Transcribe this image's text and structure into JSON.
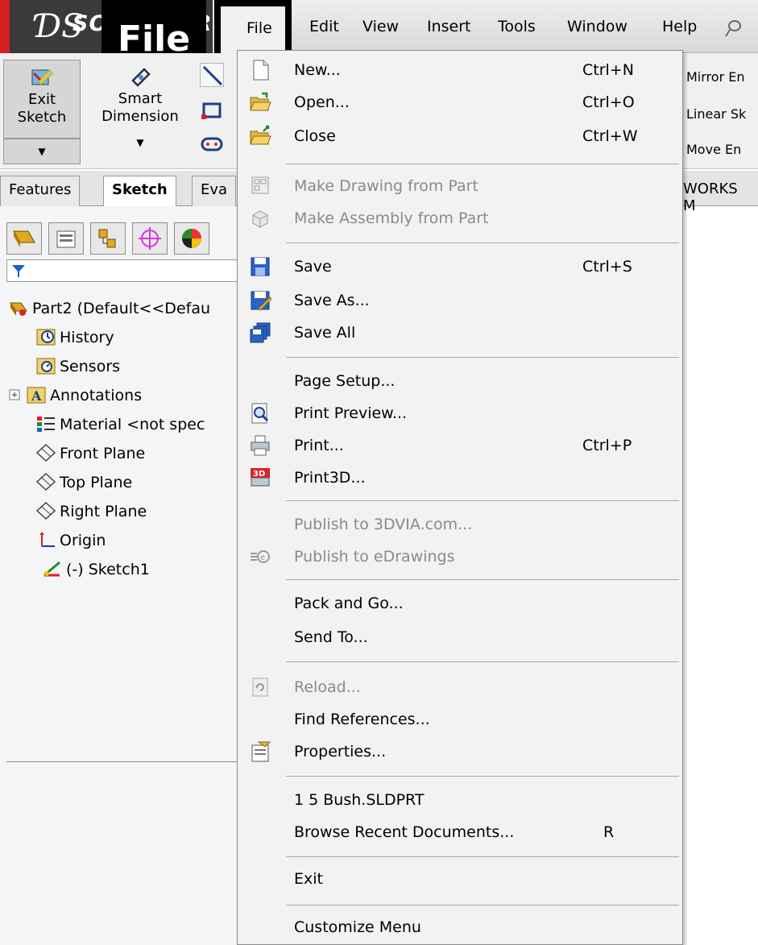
{
  "app": {
    "logo_ds": "ƊS",
    "logo_text": "SOLIDWORKS",
    "callout_label": "File"
  },
  "menubar": {
    "items": [
      "File",
      "Edit",
      "View",
      "Insert",
      "Tools",
      "Window",
      "Help"
    ]
  },
  "commands": {
    "exit_sketch": "Exit\nSketch",
    "smart_dimension": "Smart\nDimension",
    "right": [
      "Mirror En",
      "Linear Sk",
      "Move En"
    ]
  },
  "tabs": [
    "Features",
    "Sketch",
    "Eva",
    "WORKS M"
  ],
  "tree": {
    "part": "Part2  (Default<<Defau",
    "items": [
      "History",
      "Sensors",
      "Annotations",
      "Material <not spec",
      "Front Plane",
      "Top Plane",
      "Right Plane",
      "Origin",
      "(-) Sketch1"
    ]
  },
  "file_menu": {
    "items": [
      {
        "label": "New...",
        "shortcut": "Ctrl+N"
      },
      {
        "label": "Open...",
        "shortcut": "Ctrl+O"
      },
      {
        "label": "Close",
        "shortcut": "Ctrl+W"
      },
      {
        "label": "Make Drawing from Part",
        "shortcut": ""
      },
      {
        "label": "Make Assembly from Part",
        "shortcut": ""
      },
      {
        "label": "Save",
        "shortcut": "Ctrl+S"
      },
      {
        "label": "Save As...",
        "shortcut": ""
      },
      {
        "label": "Save All",
        "shortcut": ""
      },
      {
        "label": "Page Setup...",
        "shortcut": ""
      },
      {
        "label": "Print Preview...",
        "shortcut": ""
      },
      {
        "label": "Print...",
        "shortcut": "Ctrl+P"
      },
      {
        "label": "Print3D...",
        "shortcut": ""
      },
      {
        "label": "Publish to 3DVIA.com...",
        "shortcut": ""
      },
      {
        "label": "Publish to eDrawings",
        "shortcut": ""
      },
      {
        "label": "Pack and Go...",
        "shortcut": ""
      },
      {
        "label": "Send To...",
        "shortcut": ""
      },
      {
        "label": "Reload...",
        "shortcut": ""
      },
      {
        "label": "Find References...",
        "shortcut": ""
      },
      {
        "label": "Properties...",
        "shortcut": ""
      },
      {
        "label": "1 5 Bush.SLDPRT",
        "shortcut": ""
      },
      {
        "label": "Browse Recent Documents...",
        "shortcut": "R"
      },
      {
        "label": "Exit",
        "shortcut": ""
      },
      {
        "label": "Customize Menu",
        "shortcut": ""
      }
    ]
  }
}
